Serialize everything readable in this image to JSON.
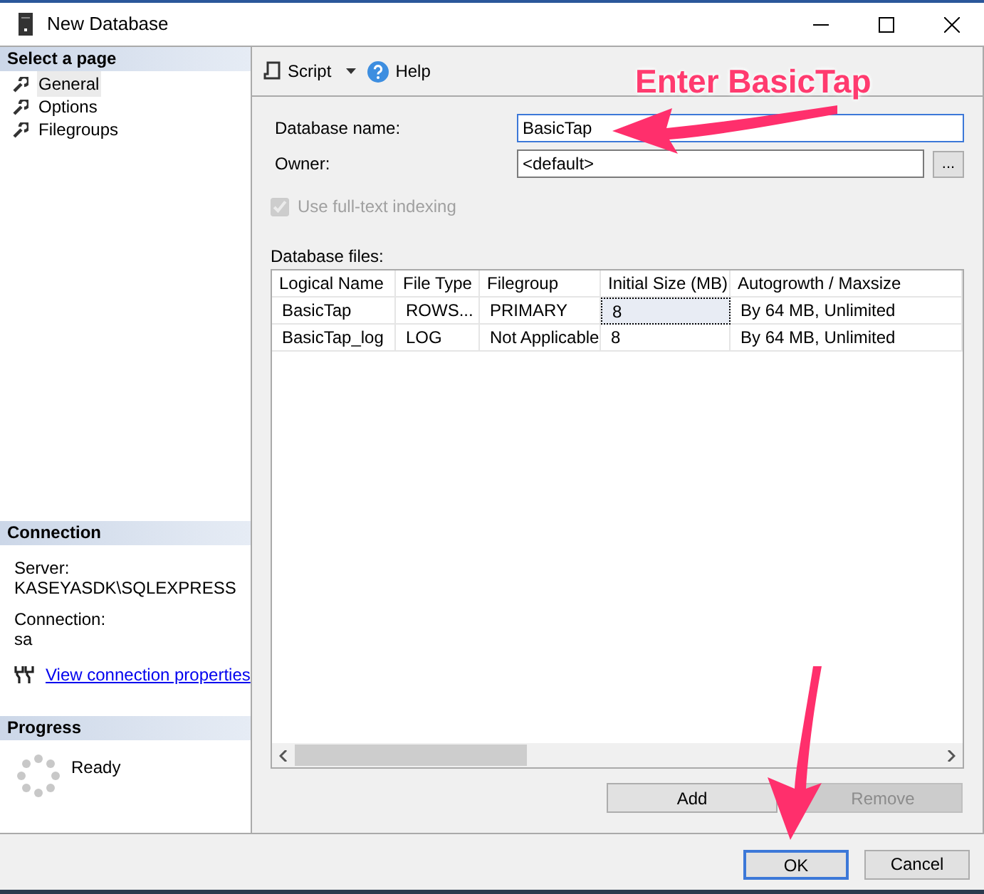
{
  "window": {
    "title": "New Database"
  },
  "sidebar": {
    "header": "Select a page",
    "items": [
      {
        "label": "General",
        "selected": true
      },
      {
        "label": "Options",
        "selected": false
      },
      {
        "label": "Filegroups",
        "selected": false
      }
    ]
  },
  "connection": {
    "header": "Connection",
    "server_label": "Server:",
    "server": "KASEYASDK\\SQLEXPRESS",
    "connection_label": "Connection:",
    "connection": "sa",
    "link": "View connection properties"
  },
  "progress": {
    "header": "Progress",
    "status": "Ready"
  },
  "toolbar": {
    "script": "Script",
    "help": "Help"
  },
  "form": {
    "name_label": "Database name:",
    "name_value": "BasicTap",
    "owner_label": "Owner:",
    "owner_value": "<default>",
    "browse": "...",
    "fulltext": {
      "label": "Use full-text indexing",
      "checked": true,
      "disabled": true
    }
  },
  "files": {
    "label": "Database files:",
    "columns": [
      "Logical Name",
      "File Type",
      "Filegroup",
      "Initial Size (MB)",
      "Autogrowth / Maxsize"
    ],
    "rows": [
      {
        "cells": [
          {
            "text": "BasicTap",
            "selected": false
          },
          {
            "text": "ROWS...",
            "selected": false
          },
          {
            "text": "PRIMARY",
            "selected": false
          },
          {
            "text": "8",
            "selected": true
          },
          {
            "text": "By 64 MB, Unlimited",
            "selected": false
          }
        ]
      },
      {
        "cells": [
          {
            "text": "BasicTap_log",
            "selected": false
          },
          {
            "text": "LOG",
            "selected": false
          },
          {
            "text": "Not Applicable",
            "selected": false
          },
          {
            "text": "8",
            "selected": false
          },
          {
            "text": "By 64 MB, Unlimited",
            "selected": false
          }
        ]
      }
    ]
  },
  "grid_buttons": [
    {
      "label": "Add",
      "disabled": false
    },
    {
      "label": "Remove",
      "disabled": true
    }
  ],
  "dialog_buttons": [
    {
      "label": "OK",
      "selected": true
    },
    {
      "label": "Cancel",
      "selected": false
    }
  ],
  "annotation": {
    "text": "Enter BasicTap"
  }
}
